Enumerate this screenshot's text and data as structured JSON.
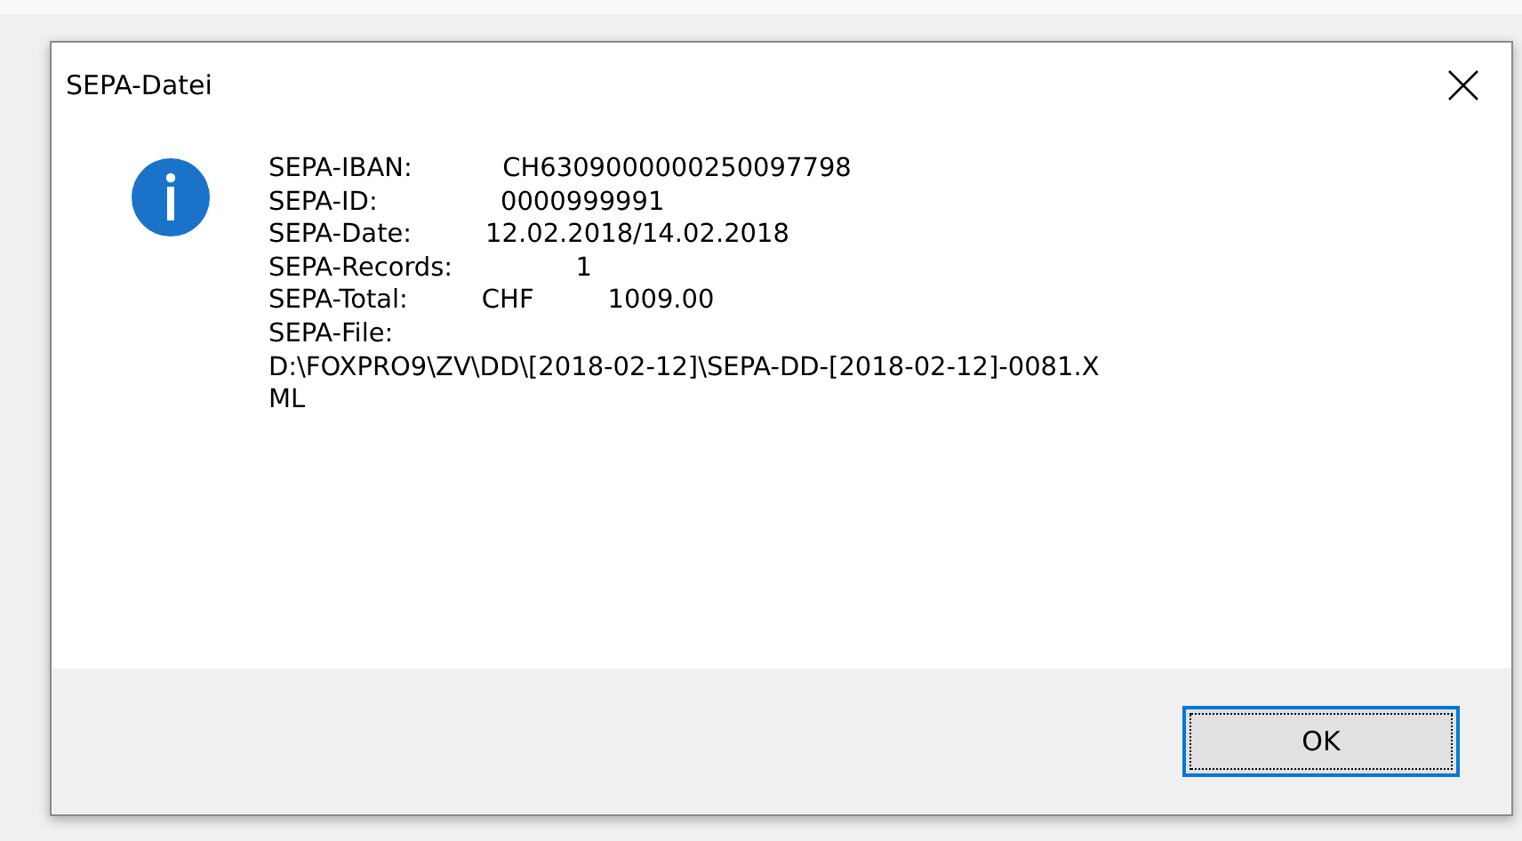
{
  "window": {
    "title": "SEPA-Datei"
  },
  "message": {
    "lines": [
      "SEPA-IBAN:           CH6309000000250097798",
      "SEPA-ID:               0000999991",
      "SEPA-Date:         12.02.2018/14.02.2018",
      "SEPA-Records:               1",
      "SEPA-Total:         CHF         1009.00",
      "SEPA-File:",
      "D:\\FOXPRO9\\ZV\\DD\\[2018-02-12]\\SEPA-DD-[2018-02-12]-0081.X",
      "ML"
    ]
  },
  "buttons": [
    {
      "label": "OK",
      "selected": true
    }
  ]
}
